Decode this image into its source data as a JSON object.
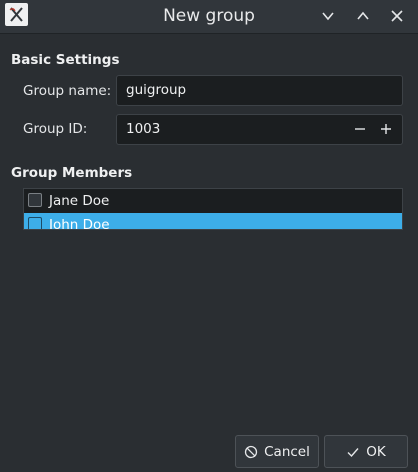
{
  "window": {
    "title": "New group",
    "icons": {
      "app": "app-icon-x",
      "minimize": "chevron-down-icon",
      "maximize": "chevron-up-icon",
      "close": "close-icon"
    }
  },
  "basic": {
    "title": "Basic Settings",
    "group_name_label": "Group name:",
    "group_name_value": "guigroup",
    "group_id_label": "Group ID:",
    "group_id_value": "1003"
  },
  "members": {
    "title": "Group Members",
    "items": [
      {
        "label": "Jane Doe",
        "checked": false,
        "selected": false
      },
      {
        "label": "John Doe",
        "checked": false,
        "selected": true
      }
    ]
  },
  "buttons": {
    "cancel_label": "Cancel",
    "ok_label": "OK"
  },
  "colors": {
    "accent": "#3daee9",
    "background": "#2a2e32",
    "field": "#1b1e20"
  }
}
